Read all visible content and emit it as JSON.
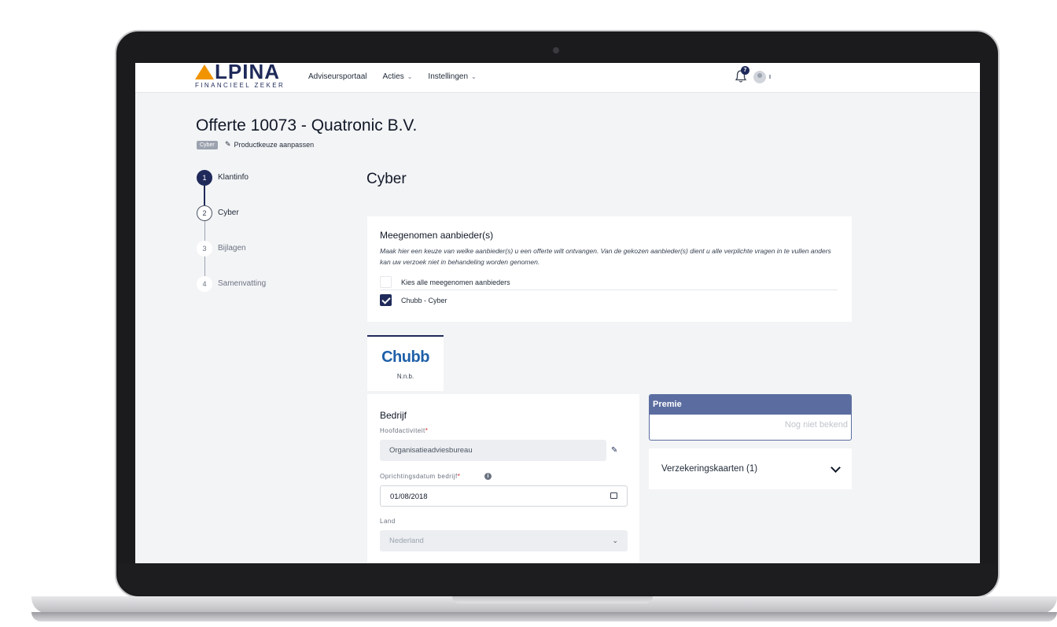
{
  "brand": {
    "name": "LPINA",
    "tagline": "FINANCIEEL ZEKER"
  },
  "nav": {
    "items": [
      {
        "label": "Adviseursportaal"
      },
      {
        "label": "Acties"
      },
      {
        "label": "Instellingen"
      }
    ]
  },
  "notifications": {
    "count": "7"
  },
  "header": {
    "title": "Offerte 10073 - Quatronic B.V.",
    "tag": "Cyber",
    "edit_link": "Productkeuze aanpassen"
  },
  "steps": [
    {
      "number": "1",
      "label": "Klantinfo"
    },
    {
      "number": "2",
      "label": "Cyber"
    },
    {
      "number": "3",
      "label": "Bijlagen"
    },
    {
      "number": "4",
      "label": "Samenvatting"
    }
  ],
  "section": {
    "title": "Cyber"
  },
  "providers": {
    "title": "Meegenomen aanbieder(s)",
    "description": "Maak hier een keuze van welke aanbieder(s) u een offerte wilt ontvangen. Van de gekozen aanbieder(s) dient u alle verplichte vragen in te vullen anders kan uw verzoek niet in behandeling worden genomen.",
    "select_all_label": "Kies alle meegenomen aanbieders",
    "options": [
      {
        "label": "Chubb - Cyber",
        "checked": true
      }
    ]
  },
  "provider_tab": {
    "logo": "Chubb",
    "subtitle": "N.n.b."
  },
  "form": {
    "title": "Bedrijf",
    "fields": {
      "hoofdactiviteit": {
        "label": "Hoofdactiviteit",
        "value": "Organisatieadviesbureau"
      },
      "oprichtingsdatum": {
        "label": "Oprichtingsdatum bedrijf",
        "value": "01/08/2018"
      },
      "land": {
        "label": "Land",
        "value": "Nederland"
      }
    }
  },
  "premie": {
    "title": "Premie",
    "value": "Nog niet bekend"
  },
  "kaarten": {
    "label": "Verzekeringskaarten (1)"
  },
  "colors": {
    "primary": "#1f2a5a",
    "accent": "#f29400",
    "premie_header": "#5b6da0"
  }
}
